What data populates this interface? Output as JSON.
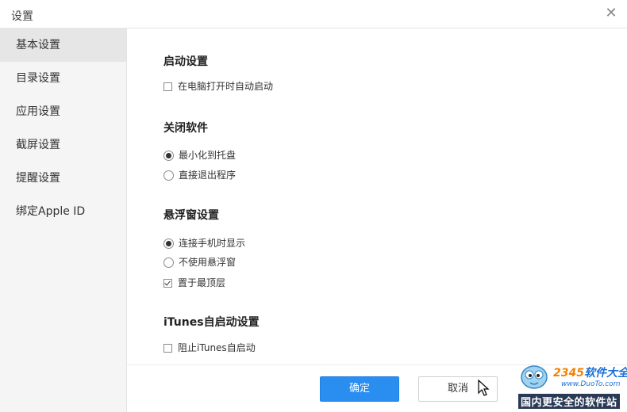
{
  "window": {
    "title": "设置"
  },
  "sidebar": {
    "items": [
      {
        "label": "基本设置"
      },
      {
        "label": "目录设置"
      },
      {
        "label": "应用设置"
      },
      {
        "label": "截屏设置"
      },
      {
        "label": "提醒设置"
      },
      {
        "label": "绑定Apple ID"
      }
    ],
    "active_index": 0
  },
  "sections": {
    "startup": {
      "title": "启动设置",
      "auto_start": {
        "label": "在电脑打开时自动启动",
        "checked": false
      }
    },
    "close": {
      "title": "关闭软件",
      "minimize": {
        "label": "最小化到托盘",
        "checked": true
      },
      "exit": {
        "label": "直接退出程序",
        "checked": false
      }
    },
    "float": {
      "title": "悬浮窗设置",
      "show_on_connect": {
        "label": "连接手机时显示",
        "checked": true
      },
      "no_float": {
        "label": "不使用悬浮窗",
        "checked": false
      },
      "on_top": {
        "label": "置于最顶层",
        "checked": true
      }
    },
    "itunes": {
      "title": "iTunes自启动设置",
      "block": {
        "label": "阻止iTunes自启动",
        "checked": false
      }
    }
  },
  "footer": {
    "ok_label": "确定",
    "cancel_label": "取消"
  },
  "watermark": {
    "logo_number": "2345",
    "logo_text": "软件大全",
    "url": "www.DuoTo.com",
    "slogan": "国内更安全的软件站"
  },
  "colors": {
    "primary": "#2a8ef0",
    "sidebar_bg": "#f5f5f5",
    "sidebar_active": "#e6e6e6"
  }
}
